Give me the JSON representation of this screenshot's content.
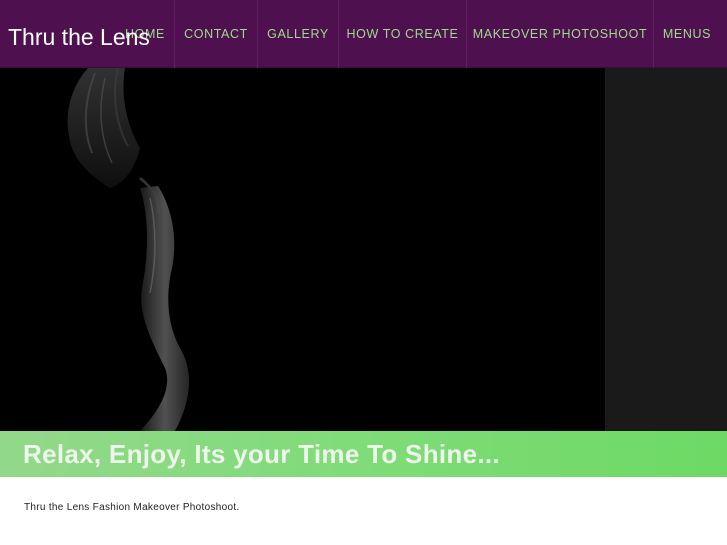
{
  "header": {
    "site_title": "Thru the Lens",
    "nav": [
      {
        "label": "HOME"
      },
      {
        "label": "CONTACT"
      },
      {
        "label": "GALLERY"
      },
      {
        "label": "HOW TO CREATE"
      },
      {
        "label": "MAKEOVER PHOTOSHOOT"
      },
      {
        "label": "MENUS"
      }
    ]
  },
  "hero": {
    "image": "dark-fashion-portrait-photo"
  },
  "banner": {
    "text": "Relax, Enjoy, Its your Time To Shine..."
  },
  "content": {
    "intro": "Thru the Lens Fashion Makeover Photoshoot."
  },
  "colors": {
    "header_bg": "#4f1050",
    "nav_text": "#9edb8c",
    "banner_green": "#7fdc78",
    "hero_bg": "#000000"
  }
}
